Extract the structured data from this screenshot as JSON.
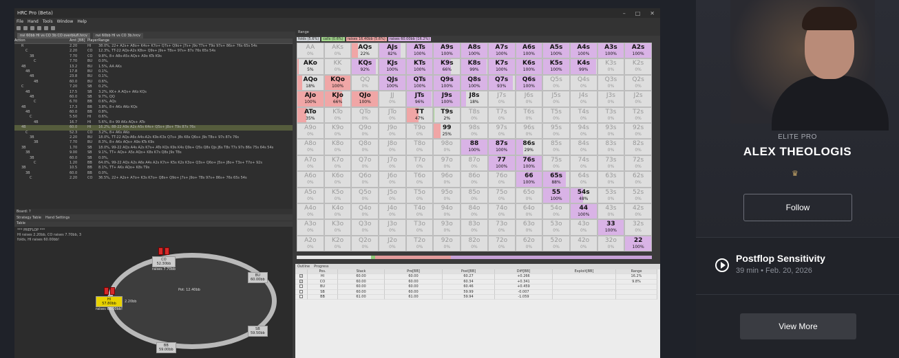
{
  "window": {
    "title": "HRC Pro (Beta)",
    "menu": [
      "File",
      "Hand",
      "Tools",
      "Window",
      "Help"
    ],
    "tabs": [
      "nvi 60bb HI vs CO 3b CO overblufl.hrcv",
      "nvi 60bb HI vs CO 3b.hrcv"
    ]
  },
  "tree": {
    "headers": [
      "Action",
      "Amt [BB]",
      "Player",
      "Range"
    ],
    "rows": [
      [
        "R",
        "2.20",
        "HI",
        "38.0%, 22+ A2s+ A8o+ K4s+ K7o+ Q7s+ Q9o+ J7s+ J9o T7s+ T9o 97s+ 86s+ 76s 65s 54s"
      ],
      [
        "C",
        "2.20",
        "CO",
        "12.3%, TT-22 AQs-A2s K8s+ Q9s+ J9s+ T8s+ 97s+ 87s 76s 65s 54s"
      ],
      [
        "3B",
        "7.70",
        "CO",
        "9.8%, 8+ A8s-A5s AQs+ A9o KTs K9s"
      ],
      [
        "C",
        "7.70",
        "BU",
        "0.0%,"
      ],
      [
        "4B",
        "13.2",
        "BU",
        "1.5%, AA AKs"
      ],
      [
        "4B",
        "17.8",
        "BU",
        "0.1%,"
      ],
      [
        "4B",
        "23.8",
        "BU",
        "0.1%,"
      ],
      [
        "4B",
        "60.0",
        "BU",
        "0.6%,"
      ],
      [
        "C",
        "7.20",
        "SB",
        "0.2%,"
      ],
      [
        "4B",
        "17.5",
        "SB",
        "3.2%, KK+ A AQs+ AKo KQs"
      ],
      [
        "4B",
        "60.0",
        "SB",
        "9.7%, QQ"
      ],
      [
        "C",
        "6.70",
        "BB",
        "0.6%, AQs"
      ],
      [
        "4B",
        "17.3",
        "BB",
        "3.8%, 8+ AKs AKo KQs"
      ],
      [
        "4B",
        "60.0",
        "BB",
        "0.8%,"
      ],
      [
        "C",
        "5.50",
        "HI",
        "0.6%,"
      ],
      [
        "4B",
        "16.7",
        "HI",
        "5.6%, 8+ 99 AKs AQs+ ATo"
      ],
      [
        "4B",
        "60.0",
        "HI",
        "16.2%, 88-22 A9s A2s A5s K4s+ Q5s+ J8s+ T9s 87s 76s"
      ],
      [
        "C",
        "52.3",
        "CO",
        "3.2%, 8+ AKs AKo"
      ],
      [
        "3B",
        "2.20",
        "BU",
        "18.0%, TT-22 AQs-A6s A4s-A2s K9s-K3s Q7s+ J8s K6s Q6s+ J9s T8s+ 97s 87s 76s"
      ],
      [
        "3B",
        "7.70",
        "BU",
        "8.3%, 8+ AKs AQs+ A9o KTs K9s"
      ],
      [
        "3B",
        "1.70",
        "SB",
        "18.0%, 99-22 AQs A4s A2s K7s+ ATo KQs K9s K4s Q9s+ Q5s Q8s Qjs J6s T8s T7s 97s 86s 75s 64s 54s"
      ],
      [
        "3B",
        "9.00",
        "SB",
        "9.1%, TT+ AQs+ A5s AQo+ K8s K7s Q8s J9s T8s"
      ],
      [
        "3B",
        "60.0",
        "SB",
        "0.0%,"
      ],
      [
        "C",
        "1.20",
        "BB",
        "64.0%, 99-22 AQs A2s A6s A4s A2s K7s+ K5s K2s K3o+ Q3s+ Q6o+ J5s+ J8o+ T3s+ T7o+ 92s"
      ],
      [
        "3B",
        "10.5",
        "BB",
        "8.1%, TT+ AKs AQo+ K8s T9s"
      ],
      [
        "3B",
        "60.0",
        "BB",
        "0.0%,"
      ],
      [
        "C",
        "2.20",
        "CO",
        "36.5%, 22+ A2s+ A7o+ K3s K7o+ Q8s+ Q9o+ J7s+ J9o+ T8s 97s+ 86s+ 76s 65s 54s"
      ]
    ]
  },
  "board_label": "Board: ?",
  "bottom_tabs": [
    "Strategy Table",
    "Hand Settings"
  ],
  "table": {
    "title": "Table",
    "log": [
      "*** PREFLOP ***",
      "HI raises 2.20bb, CO raises 7.70bb, 3",
      "folds, HI raises 60.00bb!"
    ],
    "pot": "Pot:   12.40bb",
    "seats": {
      "co": {
        "name": "CO",
        "stack": "52.30bb",
        "action": "raises 7.70bb"
      },
      "bu": {
        "name": "BU",
        "stack": "60.00bb"
      },
      "sb": {
        "name": "SB",
        "stack": "59.50bb"
      },
      "bb": {
        "name": "BB",
        "stack": "59.00bb"
      },
      "hi": {
        "name": "HI",
        "stack": "57.80bb",
        "action": "raises 60.00bb!",
        "bet": "2.20bb"
      }
    }
  },
  "range": {
    "title": "Range",
    "legend": [
      {
        "label": "folds (5.6%)",
        "color": "#cfd3d7"
      },
      {
        "label": "calls (0.6%)",
        "color": "#a4d88e"
      },
      {
        "label": "raises 16.40bb (5.6%)",
        "color": "#f0a6a6"
      },
      {
        "label": "raises 60.00bb (16.2%)",
        "color": "#d9b3e6"
      }
    ],
    "cells": [
      [
        "AA",
        "0%"
      ],
      [
        "AKs",
        "0%"
      ],
      [
        "AQs",
        "22%"
      ],
      [
        "AJs",
        "82%"
      ],
      [
        "ATs",
        "100%"
      ],
      [
        "A9s",
        "100%"
      ],
      [
        "A8s",
        "100%"
      ],
      [
        "A7s",
        "100%"
      ],
      [
        "A6s",
        "100%"
      ],
      [
        "A5s",
        "100%"
      ],
      [
        "A4s",
        "100%"
      ],
      [
        "A3s",
        "100%"
      ],
      [
        "A2s",
        "100%"
      ],
      [
        "AKo",
        "5%"
      ],
      [
        "KK",
        "0%"
      ],
      [
        "KQs",
        "92%"
      ],
      [
        "KJs",
        "100%"
      ],
      [
        "KTs",
        "100%"
      ],
      [
        "K9s",
        "66%"
      ],
      [
        "K8s",
        "99%"
      ],
      [
        "K7s",
        "100%"
      ],
      [
        "K6s",
        "100%"
      ],
      [
        "K5s",
        "100%"
      ],
      [
        "K4s",
        "99%"
      ],
      [
        "K3s",
        "0%"
      ],
      [
        "K2s",
        "0%"
      ],
      [
        "AQo",
        "18%"
      ],
      [
        "KQo",
        "100%"
      ],
      [
        "QQ",
        "0%"
      ],
      [
        "QJs",
        "100%"
      ],
      [
        "QTs",
        "100%"
      ],
      [
        "Q9s",
        "100%"
      ],
      [
        "Q8s",
        "100%"
      ],
      [
        "Q7s",
        "93%"
      ],
      [
        "Q6s",
        "100%"
      ],
      [
        "Q5s",
        "0%"
      ],
      [
        "Q4s",
        "0%"
      ],
      [
        "Q3s",
        "0%"
      ],
      [
        "Q2s",
        "0%"
      ],
      [
        "AJo",
        "100%"
      ],
      [
        "KJo",
        "66%"
      ],
      [
        "QJo",
        "100%"
      ],
      [
        "JJ",
        "0%"
      ],
      [
        "JTs",
        "96%"
      ],
      [
        "J9s",
        "100%"
      ],
      [
        "J8s",
        "18%"
      ],
      [
        "J7s",
        "0%"
      ],
      [
        "J6s",
        "0%"
      ],
      [
        "J5s",
        "0%"
      ],
      [
        "J4s",
        "0%"
      ],
      [
        "J3s",
        "0%"
      ],
      [
        "J2s",
        "0%"
      ],
      [
        "ATo",
        "35%"
      ],
      [
        "KTo",
        "0%"
      ],
      [
        "QTo",
        "0%"
      ],
      [
        "JTo",
        "0%"
      ],
      [
        "TT",
        "47%"
      ],
      [
        "T9s",
        "2%"
      ],
      [
        "T8s",
        "0%"
      ],
      [
        "T7s",
        "0%"
      ],
      [
        "T6s",
        "0%"
      ],
      [
        "T5s",
        "0%"
      ],
      [
        "T4s",
        "0%"
      ],
      [
        "T3s",
        "0%"
      ],
      [
        "T2s",
        "0%"
      ],
      [
        "A9o",
        "0%"
      ],
      [
        "K9o",
        "0%"
      ],
      [
        "Q9o",
        "0%"
      ],
      [
        "J9o",
        "0%"
      ],
      [
        "T9o",
        "0%"
      ],
      [
        "99",
        "25%"
      ],
      [
        "98s",
        "0%"
      ],
      [
        "97s",
        "0%"
      ],
      [
        "96s",
        "0%"
      ],
      [
        "95s",
        "0%"
      ],
      [
        "94s",
        "0%"
      ],
      [
        "93s",
        "0%"
      ],
      [
        "92s",
        "0%"
      ],
      [
        "A8o",
        "0%"
      ],
      [
        "K8o",
        "0%"
      ],
      [
        "Q8o",
        "0%"
      ],
      [
        "J8o",
        "0%"
      ],
      [
        "T8o",
        "0%"
      ],
      [
        "98o",
        "0%"
      ],
      [
        "88",
        "100%"
      ],
      [
        "87s",
        "100%"
      ],
      [
        "86s",
        "29%"
      ],
      [
        "85s",
        "0%"
      ],
      [
        "84s",
        "0%"
      ],
      [
        "83s",
        "0%"
      ],
      [
        "82s",
        "0%"
      ],
      [
        "A7o",
        "0%"
      ],
      [
        "K7o",
        "0%"
      ],
      [
        "Q7o",
        "0%"
      ],
      [
        "J7o",
        "0%"
      ],
      [
        "T7o",
        "0%"
      ],
      [
        "97o",
        "0%"
      ],
      [
        "87o",
        "0%"
      ],
      [
        "77",
        "100%"
      ],
      [
        "76s",
        "100%"
      ],
      [
        "75s",
        "0%"
      ],
      [
        "74s",
        "0%"
      ],
      [
        "73s",
        "0%"
      ],
      [
        "72s",
        "0%"
      ],
      [
        "A6o",
        "0%"
      ],
      [
        "K6o",
        "0%"
      ],
      [
        "Q6o",
        "0%"
      ],
      [
        "J6o",
        "0%"
      ],
      [
        "T6o",
        "0%"
      ],
      [
        "96o",
        "0%"
      ],
      [
        "86o",
        "0%"
      ],
      [
        "76o",
        "0%"
      ],
      [
        "66",
        "100%"
      ],
      [
        "65s",
        "88%"
      ],
      [
        "64s",
        "0%"
      ],
      [
        "63s",
        "0%"
      ],
      [
        "62s",
        "0%"
      ],
      [
        "A5o",
        "0%"
      ],
      [
        "K5o",
        "0%"
      ],
      [
        "Q5o",
        "0%"
      ],
      [
        "J5o",
        "0%"
      ],
      [
        "T5o",
        "0%"
      ],
      [
        "95o",
        "0%"
      ],
      [
        "85o",
        "0%"
      ],
      [
        "75o",
        "0%"
      ],
      [
        "65o",
        "0%"
      ],
      [
        "55",
        "100%"
      ],
      [
        "54s",
        "48%"
      ],
      [
        "53s",
        "0%"
      ],
      [
        "52s",
        "0%"
      ],
      [
        "A4o",
        "0%"
      ],
      [
        "K4o",
        "0%"
      ],
      [
        "Q4o",
        "0%"
      ],
      [
        "J4o",
        "0%"
      ],
      [
        "T4o",
        "0%"
      ],
      [
        "94o",
        "0%"
      ],
      [
        "84o",
        "0%"
      ],
      [
        "74o",
        "0%"
      ],
      [
        "64o",
        "0%"
      ],
      [
        "54o",
        "0%"
      ],
      [
        "44",
        "100%"
      ],
      [
        "43s",
        "0%"
      ],
      [
        "42s",
        "0%"
      ],
      [
        "A3o",
        "0%"
      ],
      [
        "K3o",
        "0%"
      ],
      [
        "Q3o",
        "0%"
      ],
      [
        "J3o",
        "0%"
      ],
      [
        "T3o",
        "0%"
      ],
      [
        "93o",
        "0%"
      ],
      [
        "83o",
        "0%"
      ],
      [
        "73o",
        "0%"
      ],
      [
        "63o",
        "0%"
      ],
      [
        "53o",
        "0%"
      ],
      [
        "43o",
        "0%"
      ],
      [
        "33",
        "100%"
      ],
      [
        "32s",
        "0%"
      ],
      [
        "A2o",
        "0%"
      ],
      [
        "K2o",
        "0%"
      ],
      [
        "Q2o",
        "0%"
      ],
      [
        "J2o",
        "0%"
      ],
      [
        "T2o",
        "0%"
      ],
      [
        "92o",
        "0%"
      ],
      [
        "82o",
        "0%"
      ],
      [
        "72o",
        "0%"
      ],
      [
        "62o",
        "0%"
      ],
      [
        "52o",
        "0%"
      ],
      [
        "42o",
        "0%"
      ],
      [
        "32o",
        "0%"
      ],
      [
        "22",
        "100%"
      ]
    ]
  },
  "outline": {
    "tabs": [
      "Outline",
      "Progress"
    ],
    "headers": [
      "",
      "Pos.",
      "Stack",
      "Pre[BB]",
      "Post[BB]",
      "Diff[BB]",
      "Exploit[BB]",
      "Range"
    ],
    "rows": [
      [
        "x",
        "HI",
        "60.00",
        "60.00",
        "60.27",
        "+0.266",
        "",
        "16.2%"
      ],
      [
        "x",
        "CO",
        "60.00",
        "60.00",
        "60.34",
        "+0.341",
        "",
        "9.8%"
      ],
      [
        "",
        "BU",
        "60.00",
        "60.00",
        "60.46",
        "+0.459",
        "",
        ""
      ],
      [
        "",
        "SB",
        "60.00",
        "60.00",
        "59.99",
        "-0.007",
        "",
        ""
      ],
      [
        "",
        "BB",
        "61.00",
        "61.00",
        "59.94",
        "-1.059",
        "",
        ""
      ]
    ]
  },
  "profile": {
    "badge": "ELITE PRO",
    "name": "ALEX THEOLOGIS",
    "follow": "Follow",
    "crown_icon": "crown-icon"
  },
  "course": {
    "title": "Postflop Sensitivity",
    "duration": "39 min",
    "sep": "•",
    "date": "Feb. 20, 2026"
  },
  "view_more": "View More"
}
